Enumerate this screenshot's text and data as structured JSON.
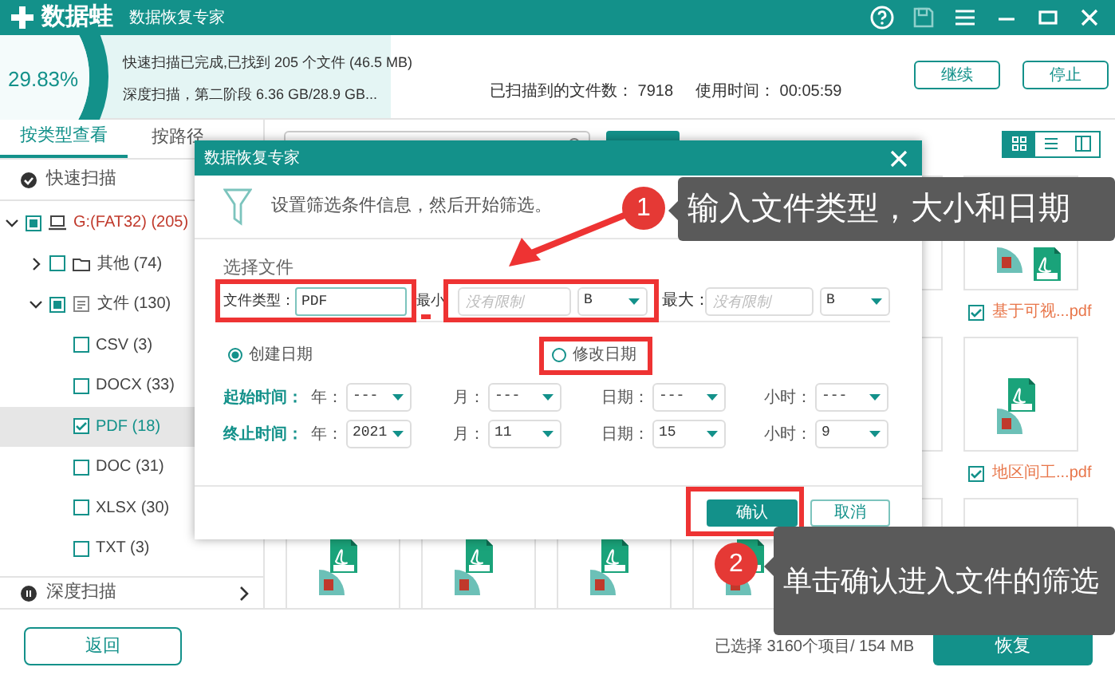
{
  "app": {
    "name": "数据蛙",
    "subtitle": "数据恢复专家"
  },
  "progress": {
    "percent": "29.83%"
  },
  "status_lines": [
    "快速扫描已完成,已找到 205 个文件 (46.5 MB)",
    "深度扫描，第二阶段 6.36 GB/28.9 GB..."
  ],
  "scan_stats": [
    {
      "label": "已扫描到的文件数：",
      "value": "7918"
    },
    {
      "label": "使用时间：",
      "value": "00:05:59"
    }
  ],
  "scan_buttons": [
    "继续",
    "停止"
  ],
  "view_tabs": [
    {
      "label": "按类型查看",
      "selected": true
    },
    {
      "label": "按路径",
      "selected": false
    }
  ],
  "view_modes": [
    {
      "kind": "grid",
      "selected": true
    },
    {
      "kind": "list",
      "selected": false
    },
    {
      "kind": "detail",
      "selected": false
    }
  ],
  "tree": {
    "header": "快速扫描",
    "items": [
      {
        "label": "G:(FAT32) (205)",
        "kind": "drive",
        "checked": false,
        "partial": true,
        "expanded": true,
        "selected": false,
        "children": [
          {
            "label": "其他 (74)",
            "kind": "folder",
            "checked": false,
            "partial": false,
            "expanded": false,
            "selected": false
          },
          {
            "label": "文件 (130)",
            "kind": "docs",
            "checked": false,
            "partial": true,
            "expanded": true,
            "selected": false,
            "children": [
              {
                "label": "CSV (3)",
                "checked": false,
                "partial": false,
                "selected": false
              },
              {
                "label": "DOCX (33)",
                "checked": false,
                "partial": false,
                "selected": false
              },
              {
                "label": "PDF (18)",
                "checked": true,
                "partial": false,
                "selected": true
              },
              {
                "label": "DOC (31)",
                "checked": false,
                "partial": false,
                "selected": false
              },
              {
                "label": "XLSX (30)",
                "checked": false,
                "partial": false,
                "selected": false
              },
              {
                "label": "TXT (3)",
                "checked": false,
                "partial": false,
                "selected": false
              }
            ]
          }
        ]
      }
    ]
  },
  "deep_scan": "深度扫描",
  "back_button": "返回",
  "files": [
    {
      "name": "基于可视...pdf",
      "checked": true
    },
    {
      "name": "地区间工...pdf",
      "checked": true
    }
  ],
  "selection_summary": "已选择 3160个项目/ 154 MB",
  "recover_button": "恢复",
  "dialog": {
    "title": "数据恢复专家",
    "intro": "设置筛选条件信息，然后开始筛选。",
    "section": "选择文件",
    "type_label": "文件类型：",
    "type_value": "PDF",
    "min_label": "最小",
    "min_placeholder": "没有限制",
    "min_unit": "B",
    "max_label": "最大：",
    "max_placeholder": "没有限制",
    "max_unit": "B",
    "date_options": [
      {
        "label": "创建日期",
        "selected": true
      },
      {
        "label": "修改日期",
        "selected": false
      }
    ],
    "time_rows": [
      {
        "label": "起始时间：",
        "fields": [
          {
            "label": "年：",
            "value": "---"
          },
          {
            "label": "月：",
            "value": "---"
          },
          {
            "label": "日期：",
            "value": "---"
          },
          {
            "label": "小时：",
            "value": "---"
          }
        ]
      },
      {
        "label": "终止时间：",
        "fields": [
          {
            "label": "年：",
            "value": "2021"
          },
          {
            "label": "月：",
            "value": "11"
          },
          {
            "label": "日期：",
            "value": "15"
          },
          {
            "label": "小时：",
            "value": "9"
          }
        ]
      }
    ],
    "confirm": "确认",
    "cancel": "取消"
  },
  "callouts": [
    {
      "number": "1",
      "text": "输入文件类型，大小和日期"
    },
    {
      "number": "2",
      "text": "单击确认进入文件的筛选"
    }
  ]
}
